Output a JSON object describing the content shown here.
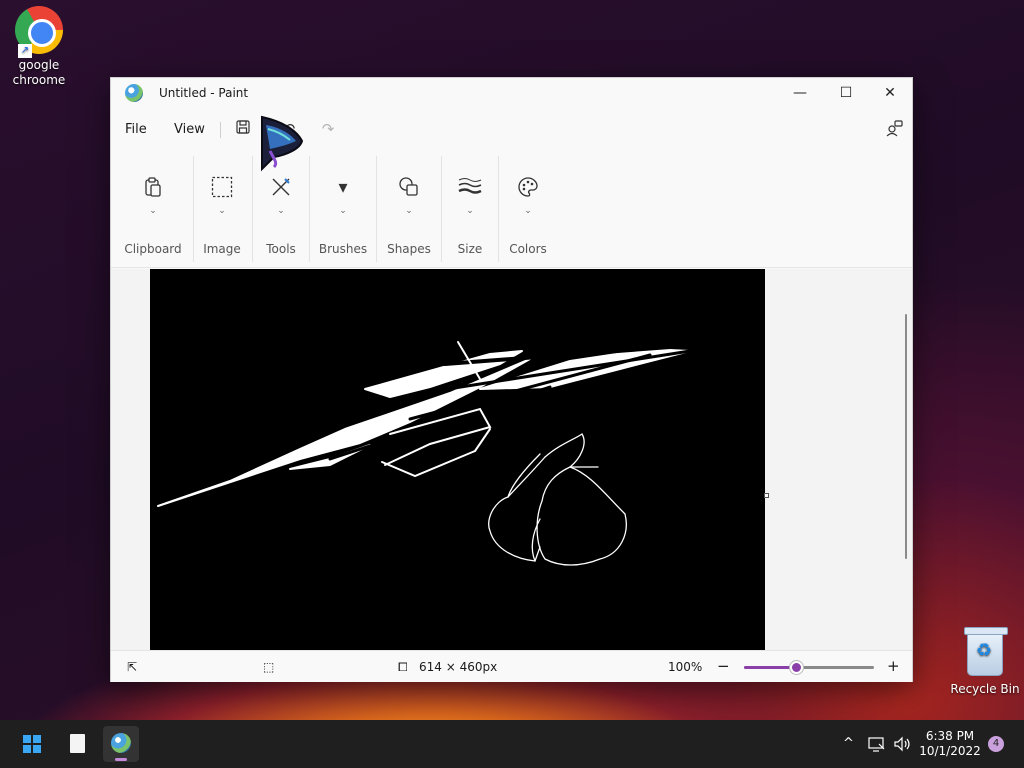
{
  "desktop": {
    "icons": [
      {
        "label": "google chroome",
        "icon": "chrome-icon"
      },
      {
        "label": "Recycle Bin",
        "icon": "recycle-bin-icon"
      }
    ]
  },
  "window": {
    "title": "Untitled - Paint",
    "menu": {
      "file": "File",
      "view": "View"
    },
    "ribbon": {
      "groups": [
        "Clipboard",
        "Image",
        "Tools",
        "Brushes",
        "Shapes",
        "Size",
        "Colors"
      ]
    },
    "canvas": {
      "background": "#000000",
      "stroke": "#ffffff"
    },
    "status": {
      "dimensions": "614 × 460px",
      "zoom": "100%",
      "zoom_level": 0.4
    }
  },
  "taskbar": {
    "time": "6:38 PM",
    "date": "10/1/2022",
    "notifications": "4"
  },
  "colors": {
    "accent": "#8b3fa8",
    "start": "#3ba6f1"
  }
}
